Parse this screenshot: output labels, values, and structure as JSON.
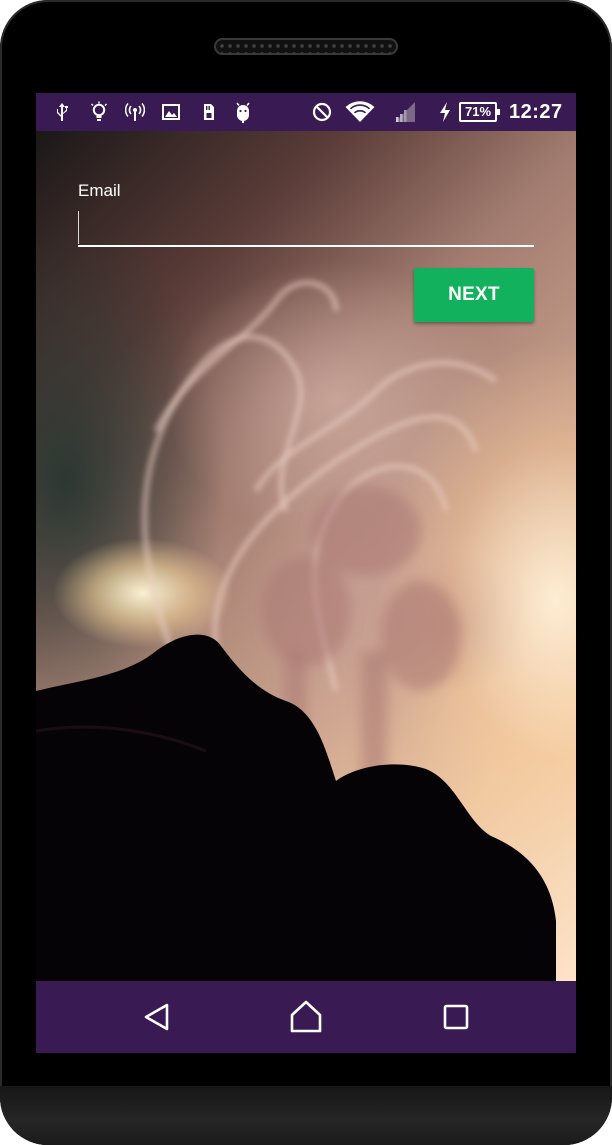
{
  "device": {
    "frame_color": "#000000",
    "status_bar_color": "#3a1a52",
    "nav_bar_color": "#3a1a52"
  },
  "status_bar": {
    "left_icons": [
      "usb-icon",
      "lightbulb-icon",
      "hotspot-icon",
      "image-icon",
      "sd-card-icon",
      "android-icon"
    ],
    "right_icons": [
      "do-not-disturb-icon",
      "wifi-icon",
      "signal-icon",
      "charging-icon"
    ],
    "battery_percent": "71%",
    "time": "12:27"
  },
  "login": {
    "email_label": "Email",
    "email_value": "",
    "next_label": "NEXT",
    "accent_color": "#12b15e",
    "background_image": "smoke-photo"
  },
  "nav_bar": {
    "buttons": [
      "back-icon",
      "home-icon",
      "recents-icon"
    ]
  }
}
